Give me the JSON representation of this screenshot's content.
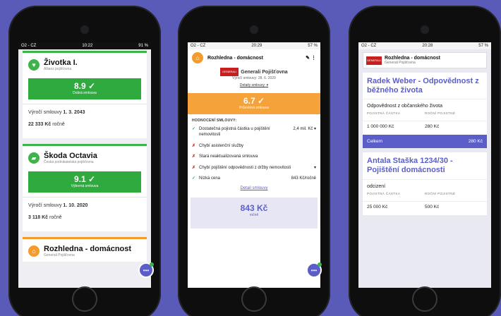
{
  "phone1": {
    "status": {
      "carrier": "O2 - CZ",
      "time": "10:22",
      "battery": "91 %"
    },
    "cards": [
      {
        "name": "Životka I.",
        "insurer": "Allianz pojišťovna",
        "score": "8.9",
        "score_label": "Dobrá smlouva",
        "anniv_label": "Výročí smlouvy",
        "anniv": "1. 3. 2043",
        "price": "22 333 Kč",
        "period": "ročně"
      },
      {
        "name": "Škoda Octavia",
        "insurer": "Česká podnikatelská pojišťovna",
        "score": "9.1",
        "score_label": "Výborná smlouva",
        "anniv_label": "Výročí smlouvy",
        "anniv": "1. 10. 2020",
        "price": "3 118 Kč",
        "period": "ročně"
      }
    ],
    "partial": {
      "name": "Rozhledna - domácnost",
      "insurer": "Generali Pojišťovna"
    }
  },
  "phone2": {
    "status": {
      "carrier": "O2 - CZ",
      "time": "20:29",
      "battery": "57 %"
    },
    "title": "Rozhledna - domácnost",
    "insurer": "Generali Pojišťovna",
    "anniv": "Výročí smlouvy: 28. 6. 2020",
    "details": "Detaily smlouvy:",
    "score": "6.7",
    "score_label": "Průměrná smlouva",
    "eval_title": "HODNOCENÍ SMLOUVY:",
    "items": [
      {
        "mark": "✓",
        "kind": "ok",
        "text": "Dostatečná pojistná částka u pojištění nemovitosti",
        "val": "2,4 mil. Kč ▾"
      },
      {
        "mark": "✗",
        "kind": "bad",
        "text": "Chybí asistenční služby",
        "val": ""
      },
      {
        "mark": "✗",
        "kind": "bad",
        "text": "Stará neaktualizovaná smlouva",
        "val": ""
      },
      {
        "mark": "✗",
        "kind": "bad",
        "text": "Chybí pojištění odpovědnosti z držby nemovitosti",
        "val": "▾"
      },
      {
        "mark": "✓",
        "kind": "ok",
        "text": "Nízká cena",
        "val": "843 Kč/ročně"
      }
    ],
    "link": "Detail smlouvy",
    "price": "843 Kč",
    "price_period": "ročně"
  },
  "phone3": {
    "status": {
      "carrier": "O2 - CZ",
      "time": "20:28",
      "battery": "57 %"
    },
    "top": {
      "name": "Rozhledna - domácnost",
      "insurer": "Generali Pojišťovna"
    },
    "blocks": [
      {
        "heading": "Radek Weber - Odpovědnost z běžného života",
        "coverage": "Odpovědnost z občanského života",
        "col1": "POJISTNÁ ČÁSTKA",
        "col2": "ROČNÍ POJISTNÉ",
        "v1": "1 000 000 Kč",
        "v2": "280 Kč",
        "total_label": "Celkem",
        "total": "280 Kč"
      },
      {
        "heading": "Antala Staška 1234/30 - Pojištění domácnosti",
        "coverage": "odcizení",
        "col1": "POJISTNÁ ČÁSTKA",
        "col2": "ROČNÍ POJISTNÉ",
        "v1": "25 000 Kč",
        "v2": "500 Kč"
      }
    ]
  },
  "icons": {
    "heart": "heart-icon",
    "car": "car-icon",
    "house": "house-icon",
    "chat": "chat-icon"
  },
  "colors": {
    "green": "#2eaa3f",
    "orange": "#f5a23a",
    "purple": "#5b5ec8",
    "bg": "#5a5bb8"
  }
}
